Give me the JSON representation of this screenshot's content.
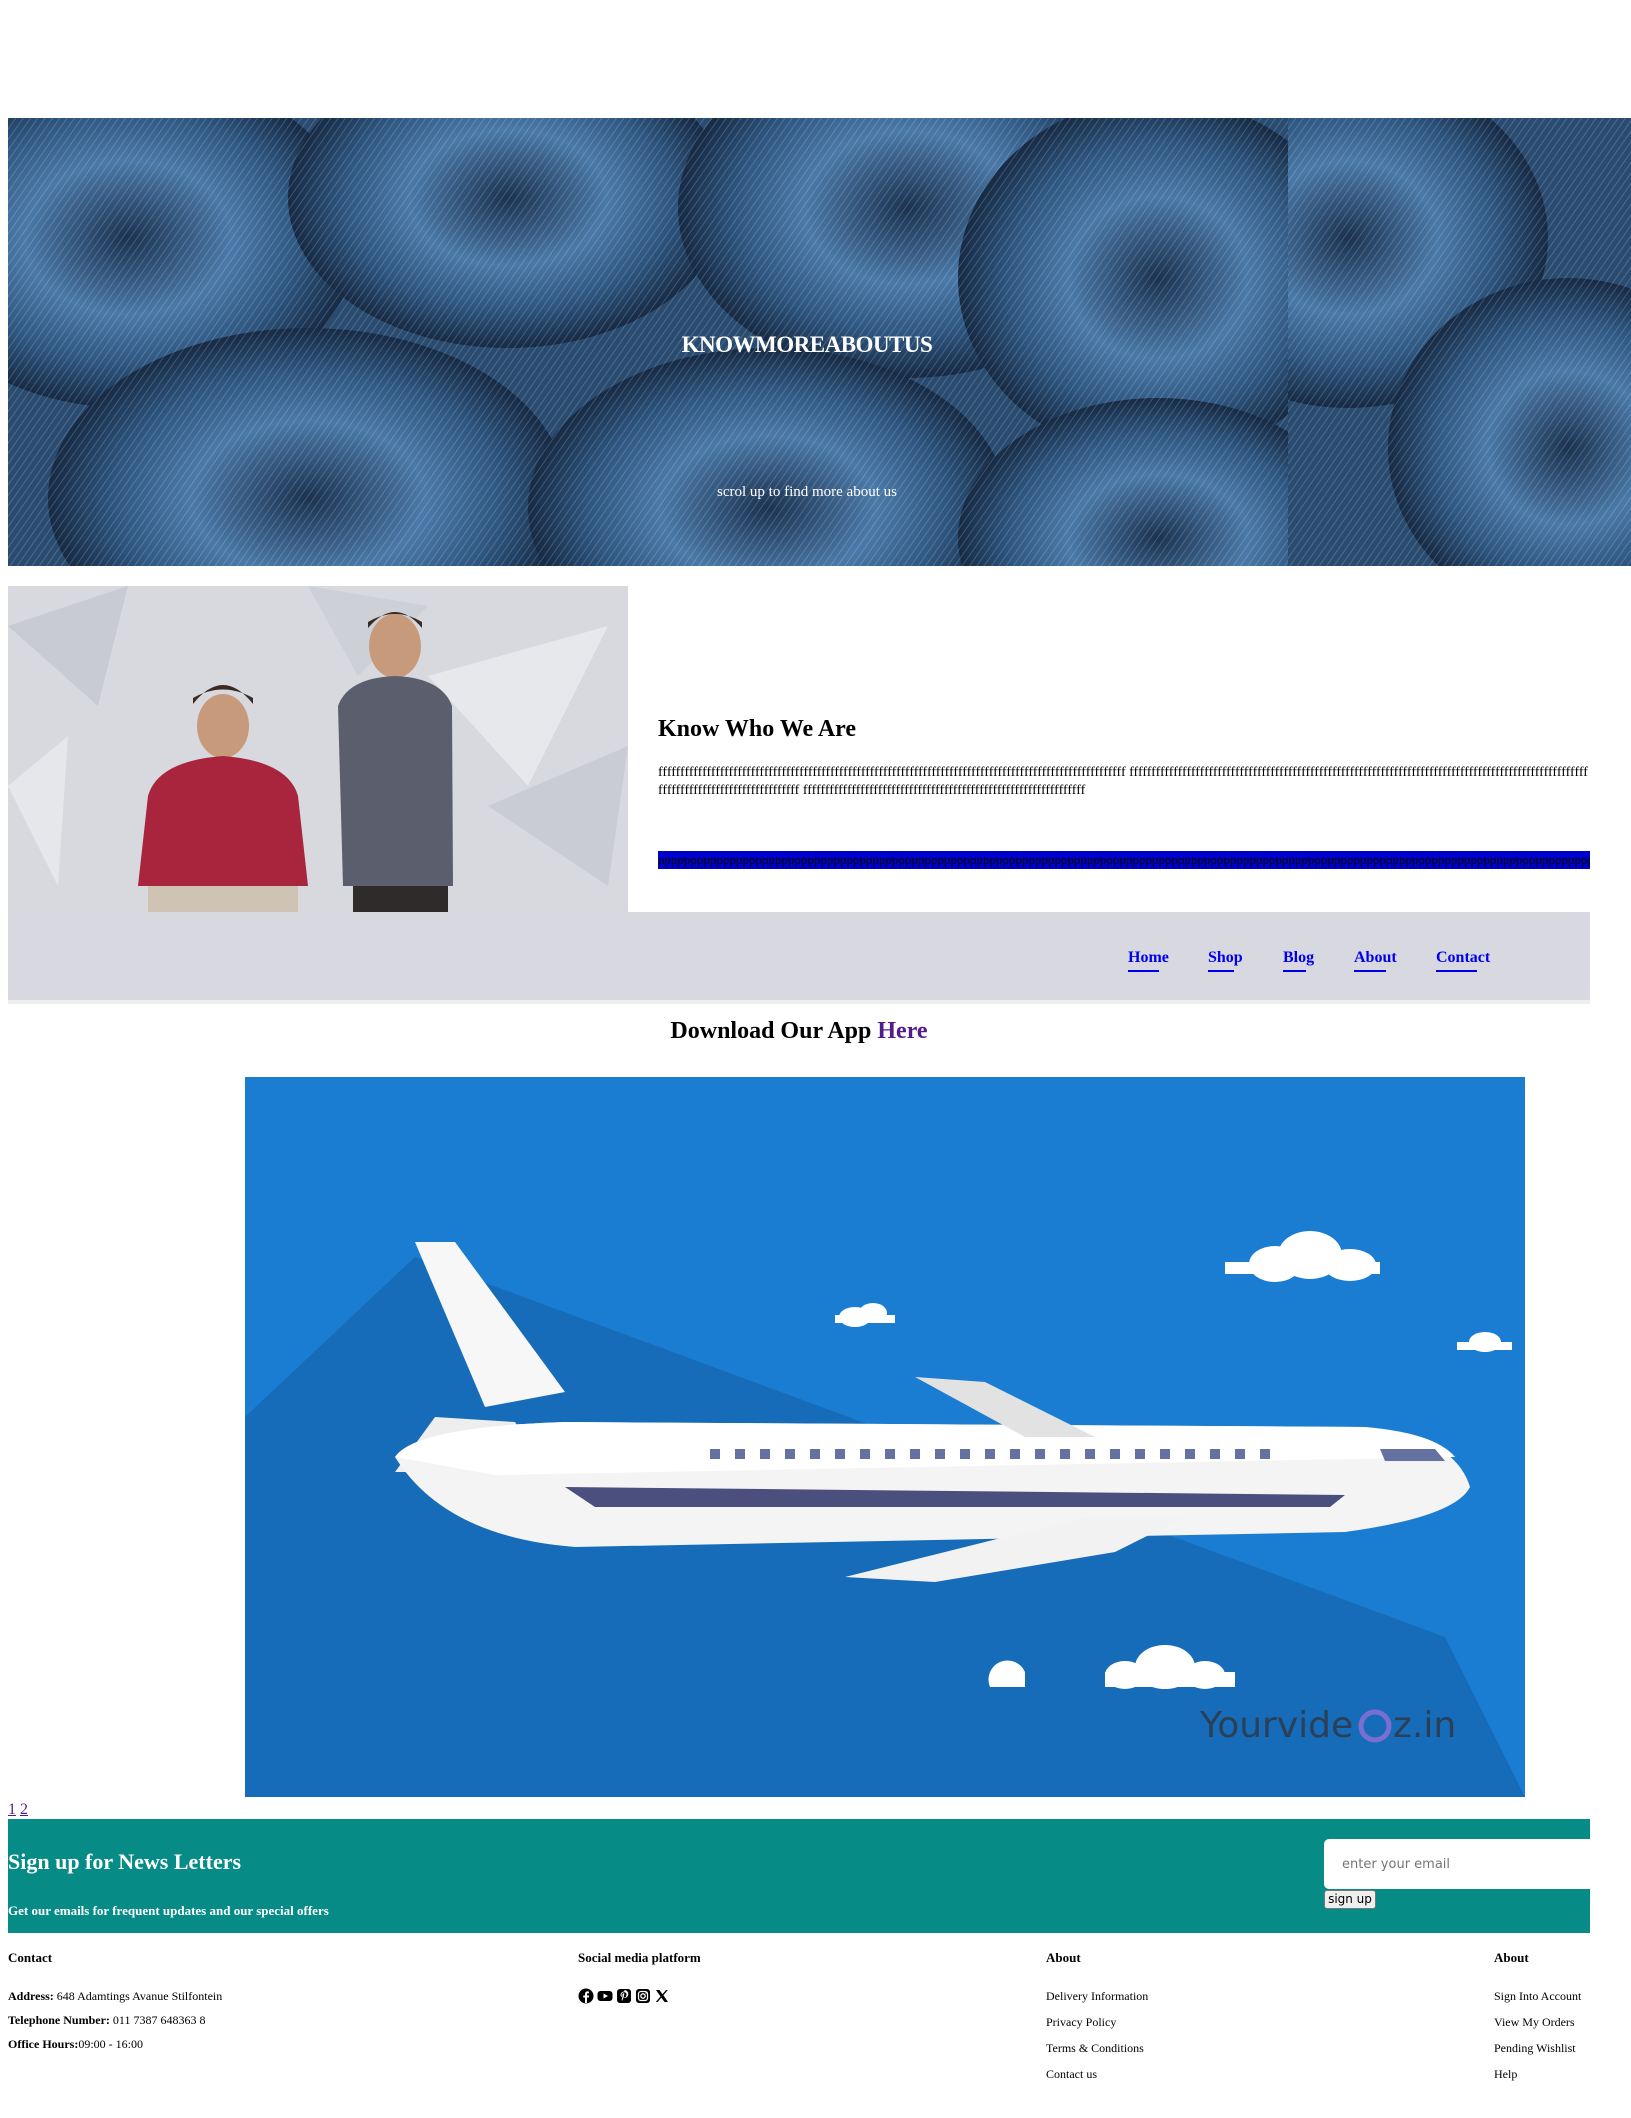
{
  "hero": {
    "title": "KNOWMOREABOUTUS",
    "subtitle": "scrol up to find more about us"
  },
  "about": {
    "title": "Know Who We Are",
    "text": "ffffffffffffffffffffffffffffffffffffffffffffffffffffffffffffffffffffffffffffffffffffffffffffffffffffffffff ffffffffffffffffffffffffffffffffffffffffffffffffffffffffffffffffffffffffffffffffffffffffffffffffffffffffffffffffffffffffffffffffffffffff ffffffffffffffffffffffffffffffffffffffffffffffffffffffffffffffff",
    "bar_text": "pppppppppppppppppppppppppppppppppppppppppppppppppppppppppppppppppppppppppppppppppppppppppppppppppppppppppppppppppppppppppppppppppppppppppppppppppppppppppppppppppppppppppppppppppppppppppp"
  },
  "nav": {
    "items": [
      {
        "label": "Home"
      },
      {
        "label": "Shop"
      },
      {
        "label": "Blog"
      },
      {
        "label": "About"
      },
      {
        "label": "Contact"
      }
    ],
    "link_color": "#0000ee"
  },
  "app": {
    "title_prefix": "Download Our App",
    "title_link": "Here",
    "watermark_a": "Yourvide",
    "watermark_b": "z.in"
  },
  "pager": {
    "pages": [
      "1",
      "2"
    ]
  },
  "newsletter": {
    "title": "Sign up for News Letters",
    "subtitle": "Get our emails for frequent updates and our special offers",
    "placeholder": "enter your email",
    "button_label": "sign up",
    "background": "#068b86"
  },
  "footer": {
    "contact": {
      "heading": "Contact",
      "address_label": "Address:",
      "address": "648 Adamtings Avanue Stilfontein",
      "phone_label": "Telephone Number:",
      "phone": "011 7387 648363 8",
      "hours_label": "Office Hours:",
      "hours": "09:00 - 16:00"
    },
    "social": {
      "heading": "Social media platform",
      "icons": [
        "facebook-icon",
        "youtube-icon",
        "pinterest-icon",
        "instagram-icon",
        "x-twitter-icon"
      ]
    },
    "about": {
      "heading": "About",
      "links": [
        "Delivery Information",
        "Privacy Policy",
        "Terms & Conditions",
        "Contact us"
      ]
    },
    "account": {
      "heading": "About",
      "links": [
        "Sign Into Account",
        "View My Orders",
        "Pending Wishlist",
        "Help"
      ]
    }
  }
}
